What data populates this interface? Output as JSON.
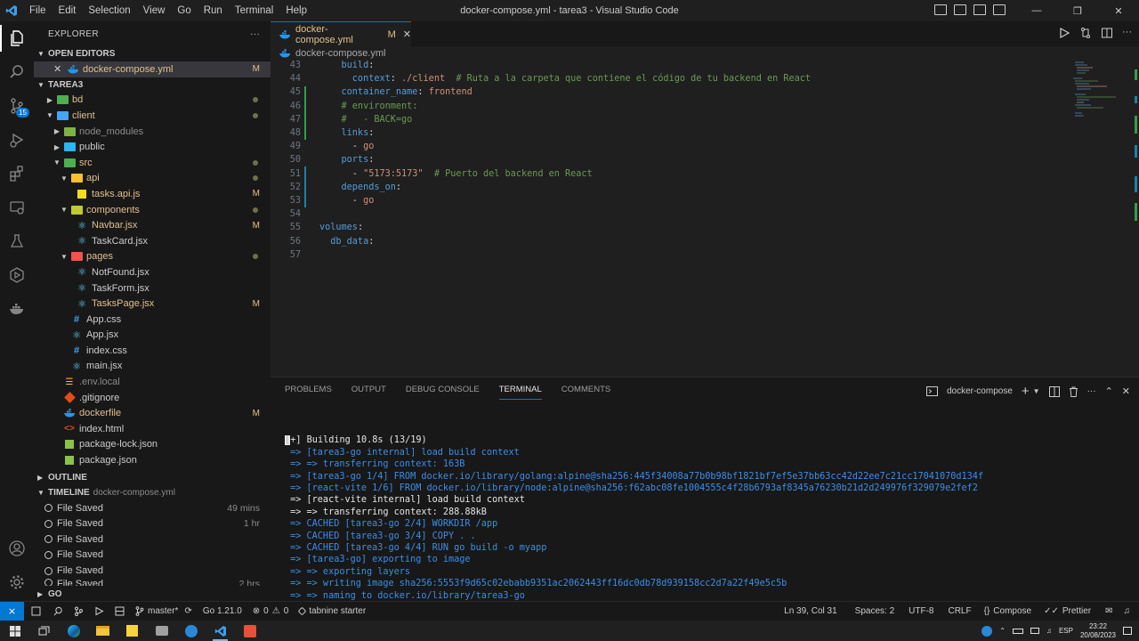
{
  "window": {
    "title": "docker-compose.yml - tarea3 - Visual Studio Code",
    "menu": [
      "File",
      "Edit",
      "Selection",
      "View",
      "Go",
      "Run",
      "Terminal",
      "Help"
    ]
  },
  "activity": {
    "scm_badge": "15"
  },
  "sidebar": {
    "header": "EXPLORER",
    "more": "···",
    "open_editors": {
      "label": "OPEN EDITORS",
      "items": [
        {
          "name": "docker-compose.yml",
          "status": "M"
        }
      ]
    },
    "workspace": {
      "label": "TAREA3",
      "tree": [
        {
          "name": "bd",
          "status": "dot"
        },
        {
          "name": "client",
          "status": "dot"
        },
        {
          "name": "node_modules",
          "status": ""
        },
        {
          "name": "public",
          "status": ""
        },
        {
          "name": "src",
          "status": "dot"
        },
        {
          "name": "api",
          "status": "dot"
        },
        {
          "name": "tasks.api.js",
          "status": "M"
        },
        {
          "name": "components",
          "status": "dot"
        },
        {
          "name": "Navbar.jsx",
          "status": "M"
        },
        {
          "name": "TaskCard.jsx",
          "status": ""
        },
        {
          "name": "pages",
          "status": "dot"
        },
        {
          "name": "NotFound.jsx",
          "status": ""
        },
        {
          "name": "TaskForm.jsx",
          "status": ""
        },
        {
          "name": "TasksPage.jsx",
          "status": "M"
        },
        {
          "name": "App.css",
          "status": ""
        },
        {
          "name": "App.jsx",
          "status": ""
        },
        {
          "name": "index.css",
          "status": ""
        },
        {
          "name": "main.jsx",
          "status": ""
        },
        {
          "name": ".env.local",
          "status": ""
        },
        {
          "name": ".gitignore",
          "status": ""
        },
        {
          "name": "dockerfile",
          "status": "M"
        },
        {
          "name": "index.html",
          "status": ""
        },
        {
          "name": "package-lock.json",
          "status": ""
        },
        {
          "name": "package.json",
          "status": ""
        }
      ]
    },
    "outline_label": "OUTLINE",
    "timeline": {
      "label": "TIMELINE",
      "file": "docker-compose.yml",
      "entries": [
        {
          "label": "File Saved",
          "time": "49 mins"
        },
        {
          "label": "File Saved",
          "time": "1 hr"
        },
        {
          "label": "File Saved",
          "time": ""
        },
        {
          "label": "File Saved",
          "time": ""
        },
        {
          "label": "File Saved",
          "time": ""
        },
        {
          "label": "File Saved",
          "time": "2 hrs"
        }
      ]
    },
    "go_label": "GO"
  },
  "editor": {
    "tab": {
      "label": "docker-compose.yml",
      "status": "M"
    },
    "breadcrumb": "docker-compose.yml",
    "lines": [
      {
        "n": "43",
        "text": "    build:"
      },
      {
        "n": "44",
        "text": "      context: ./client  # Ruta a la carpeta que contiene el código de tu backend en React"
      },
      {
        "n": "45",
        "text": "    container_name: frontend"
      },
      {
        "n": "46",
        "text": "    # environment:"
      },
      {
        "n": "47",
        "text": "    #   - BACK=go"
      },
      {
        "n": "48",
        "text": "    links:"
      },
      {
        "n": "49",
        "text": "      - go"
      },
      {
        "n": "50",
        "text": "    ports:"
      },
      {
        "n": "51",
        "text": "      - \"5173:5173\"  # Puerto del backend en React"
      },
      {
        "n": "52",
        "text": "    depends_on:"
      },
      {
        "n": "53",
        "text": "      - go"
      },
      {
        "n": "54",
        "text": ""
      },
      {
        "n": "55",
        "text": "volumes:"
      },
      {
        "n": "56",
        "text": "  db_data:"
      },
      {
        "n": "57",
        "text": ""
      }
    ]
  },
  "panel": {
    "tabs": [
      "PROBLEMS",
      "OUTPUT",
      "DEBUG CONSOLE",
      "TERMINAL",
      "COMMENTS"
    ],
    "active_tab": "TERMINAL",
    "terminal_name": "docker-compose",
    "terminal_lines": [
      "[+] Building 10.8s (13/19)",
      " => [tarea3-go internal] load build context",
      " => => transferring context: 163B",
      " => [tarea3-go 1/4] FROM docker.io/library/golang:alpine@sha256:445f34008a77b0b98bf1821bf7ef5e37bb63cc42d22ee7c21cc17041070d134f",
      " => [react-vite 1/6] FROM docker.io/library/node:alpine@sha256:f62abc08fe1004555c4f28b6793af8345a76230b21d2d249976f329079e2fef2",
      " => [react-vite internal] load build context",
      " => => transferring context: 288.88kB",
      " => CACHED [tarea3-go 2/4] WORKDIR /app",
      " => CACHED [tarea3-go 3/4] COPY . .",
      " => CACHED [tarea3-go 4/4] RUN go build -o myapp",
      " => [tarea3-go] exporting to image",
      " => => exporting layers",
      " => => writing image sha256:5553f9d65c02ebabb9351ac2062443ff16dc0db78d939158cc2d7a22f49e5c5b",
      " => => naming to docker.io/library/tarea3-go"
    ]
  },
  "status": {
    "branch": "master*",
    "go_version": "Go 1.21.0",
    "errors": "0",
    "warnings": "0",
    "tabnine": "tabnine starter",
    "position": "Ln 39, Col 31",
    "spaces": "Spaces: 2",
    "encoding": "UTF-8",
    "eol": "CRLF",
    "language": "Compose",
    "prettier": "Prettier"
  },
  "taskbar": {
    "lang": "ESP",
    "time": "23:22",
    "date": "20/08/2023"
  },
  "colors": {
    "accent": "#0078d4",
    "modified": "#e2c08d",
    "terminal_blue": "#3b8eea"
  }
}
